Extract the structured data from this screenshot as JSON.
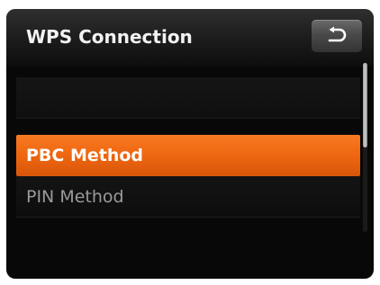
{
  "header": {
    "title": "WPS Connection",
    "back_icon": "return-arrow-icon"
  },
  "menu": {
    "items": [
      {
        "label": "",
        "state": "blank"
      },
      {
        "label": "PBC Method",
        "state": "selected"
      },
      {
        "label": "PIN Method",
        "state": "normal"
      }
    ]
  },
  "colors": {
    "accent": "#ef6610",
    "background": "#080808",
    "text": "#f2f2f2",
    "text_dim": "#9a9a9a"
  },
  "scrollbar": {
    "visible_fraction": 0.5,
    "position": 0
  }
}
